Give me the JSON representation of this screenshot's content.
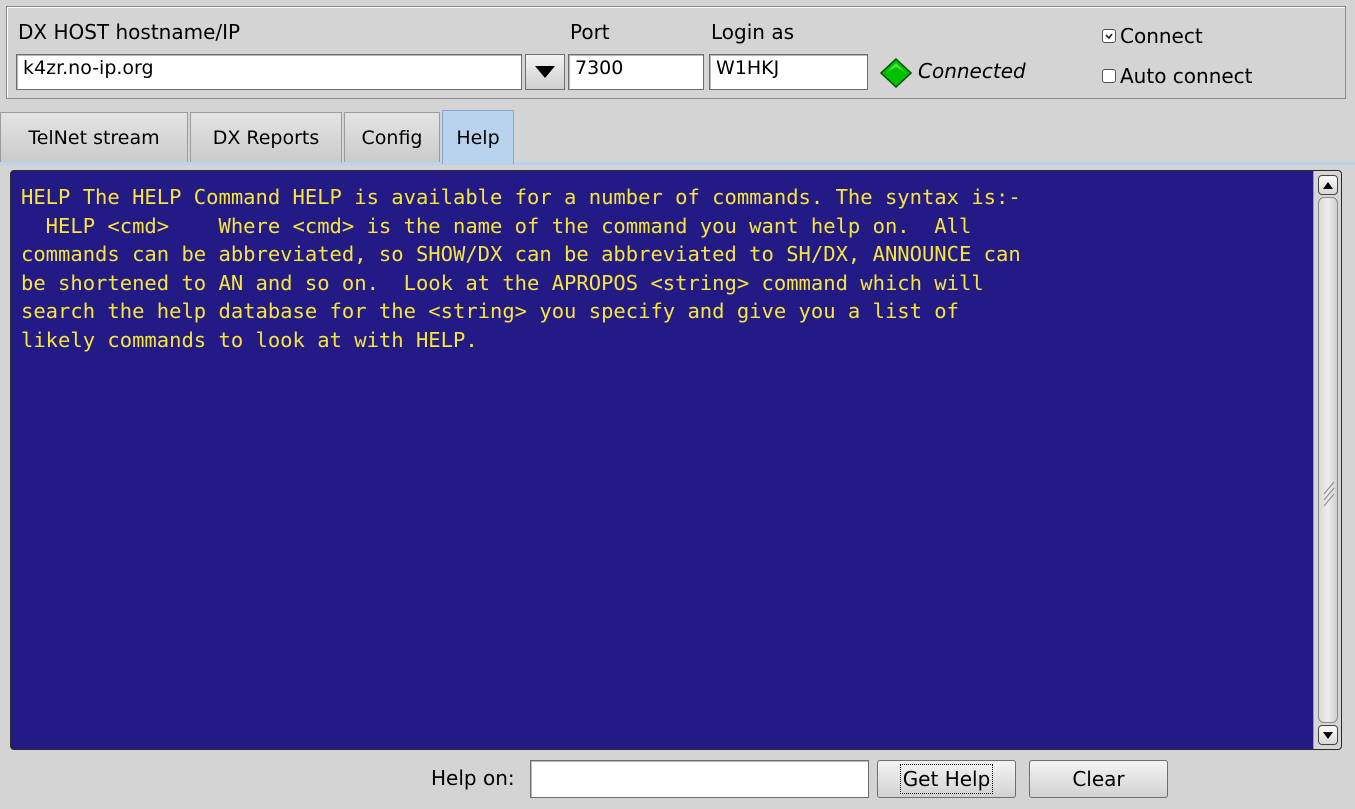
{
  "header": {
    "host_label": "DX HOST hostname/IP",
    "host_value": "k4zr.no-ip.org",
    "port_label": "Port",
    "port_value": "7300",
    "login_label": "Login as",
    "login_value": "W1HKJ",
    "status_text": "Connected",
    "status_color": "#00c000",
    "connect_label": "Connect",
    "connect_checked": true,
    "auto_connect_label": "Auto connect",
    "auto_connect_checked": false
  },
  "tabs": [
    {
      "label": "TelNet stream",
      "active": false
    },
    {
      "label": "DX Reports",
      "active": false
    },
    {
      "label": "Config",
      "active": false
    },
    {
      "label": "Help",
      "active": true
    }
  ],
  "help_text": "HELP The HELP Command HELP is available for a number of commands. The syntax is:-\n  HELP <cmd>    Where <cmd> is the name of the command you want help on.  All\ncommands can be abbreviated, so SHOW/DX can be abbreviated to SH/DX, ANNOUNCE can\nbe shortened to AN and so on.  Look at the APROPOS <string> command which will\nsearch the help database for the <string> you specify and give you a list of\nlikely commands to look at with HELP.",
  "footer": {
    "help_on_label": "Help on:",
    "help_on_value": "",
    "get_help_label": "Get Help",
    "clear_label": "Clear"
  },
  "colors": {
    "help_background": "#231a86",
    "help_foreground": "#f5e63a",
    "active_tab": "#b9d3ef"
  }
}
